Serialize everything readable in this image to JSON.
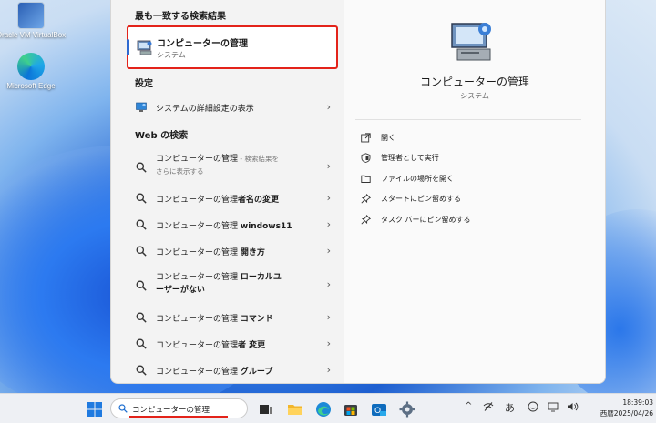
{
  "desktop": {
    "icons": [
      {
        "label": "Oracle VM VirtualBox"
      },
      {
        "label": "Microsoft Edge"
      }
    ]
  },
  "search_panel": {
    "best_match_header": "最も一致する検索結果",
    "best_match": {
      "title": "コンピューターの管理",
      "subtitle": "システム"
    },
    "settings_header": "設定",
    "settings_items": [
      {
        "label": "システムの詳細設定の表示"
      }
    ],
    "web_header": "Web の検索",
    "web_items": [
      {
        "prefix": "コンピューターの管理",
        "suffix": " - 検索結果を",
        "line2": "さらに表示する"
      },
      {
        "prefix": "コンピューターの管理",
        "bold": "者名の変更"
      },
      {
        "prefix": "コンピューターの管理 ",
        "bold": "windows11"
      },
      {
        "prefix": "コンピューターの管理 ",
        "bold": "開き方"
      },
      {
        "prefix": "コンピューターの管理 ",
        "bold": "ローカルユ",
        "line2": "ーザーがない"
      },
      {
        "prefix": "コンピューターの管理 ",
        "bold": "コマンド"
      },
      {
        "prefix": "コンピューターの管理",
        "bold": "者 変更"
      },
      {
        "prefix": "コンピューターの管理 ",
        "bold": "グループ"
      }
    ]
  },
  "detail": {
    "title": "コンピューターの管理",
    "subtitle": "システム",
    "actions": [
      {
        "label": "開く",
        "icon": "open-external-icon"
      },
      {
        "label": "管理者として実行",
        "icon": "shield-icon"
      },
      {
        "label": "ファイルの場所を開く",
        "icon": "folder-icon"
      },
      {
        "label": "スタートにピン留めする",
        "icon": "pin-icon"
      },
      {
        "label": "タスク バーにピン留めする",
        "icon": "pin-icon"
      }
    ]
  },
  "taskbar": {
    "search_value": "コンピューターの管理",
    "ime_mode": "あ",
    "time": "18:39:03",
    "date": "西暦2025/04/26"
  },
  "colors": {
    "highlight": "#e3231a",
    "accent": "#2e6ad1"
  }
}
